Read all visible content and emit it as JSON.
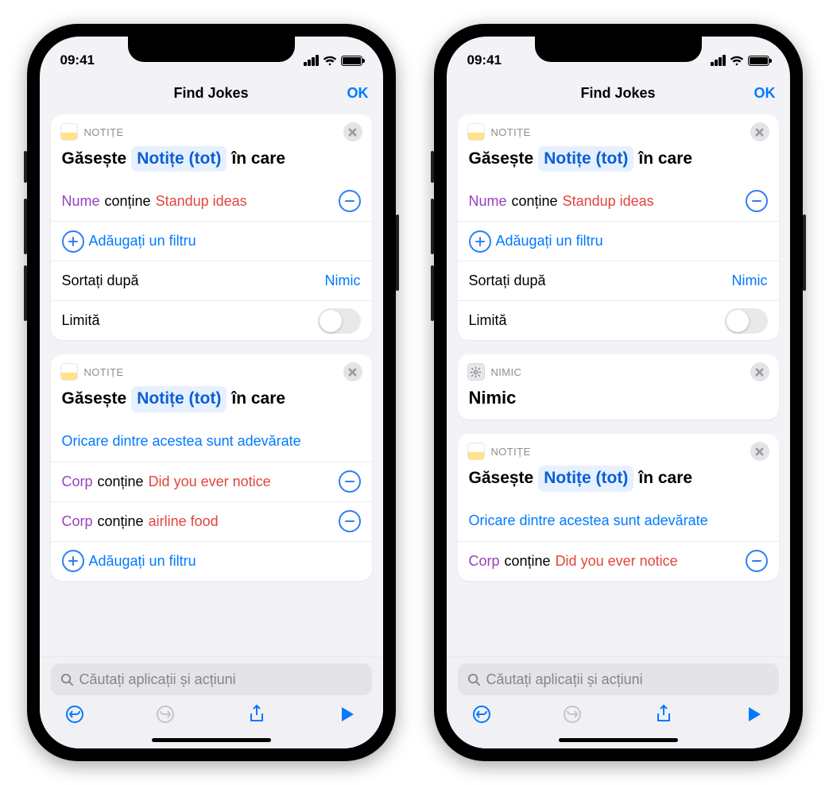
{
  "status": {
    "time": "09:41"
  },
  "nav": {
    "title": "Find Jokes",
    "done": "OK"
  },
  "labels": {
    "notes_app": "NOTIȚE",
    "nothing_app": "NIMIC",
    "find_prefix": "Găsește",
    "find_suffix": "în care",
    "notes_all_token": "Notițe (tot)",
    "add_filter": "Adăugați un filtru",
    "sort_by": "Sortați după",
    "nothing": "Nimic",
    "limit": "Limită",
    "any_true": "Oricare dintre acestea sunt adevărate"
  },
  "filters": {
    "name_key": "Nume",
    "body_key": "Corp",
    "contains": "conține",
    "standup": "Standup ideas",
    "notice": "Did you ever notice",
    "airline": "airline food"
  },
  "search": {
    "placeholder": "Căutați aplicații și acțiuni"
  }
}
